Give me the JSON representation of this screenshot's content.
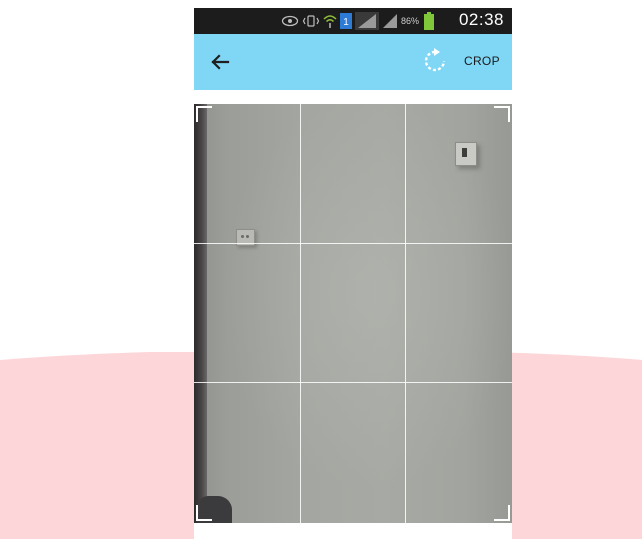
{
  "status_bar": {
    "battery_percent": "86%",
    "time": "02:38",
    "icons": [
      "eye-icon",
      "vibrate-icon",
      "wifi-icon",
      "sim-one-icon",
      "signal-icon",
      "signal-icon-2",
      "battery-icon"
    ]
  },
  "app_bar": {
    "back_icon": "arrow-left-icon",
    "rotate_icon": "rotate-icon",
    "crop_label": "CROP"
  },
  "crop": {
    "grid_rows": 3,
    "grid_cols": 3
  },
  "colors": {
    "app_bar_bg": "#7fd6f5",
    "status_bar_bg": "#1c1c1c",
    "page_band": "#fdd6d9",
    "grid_line": "#ffffff"
  }
}
